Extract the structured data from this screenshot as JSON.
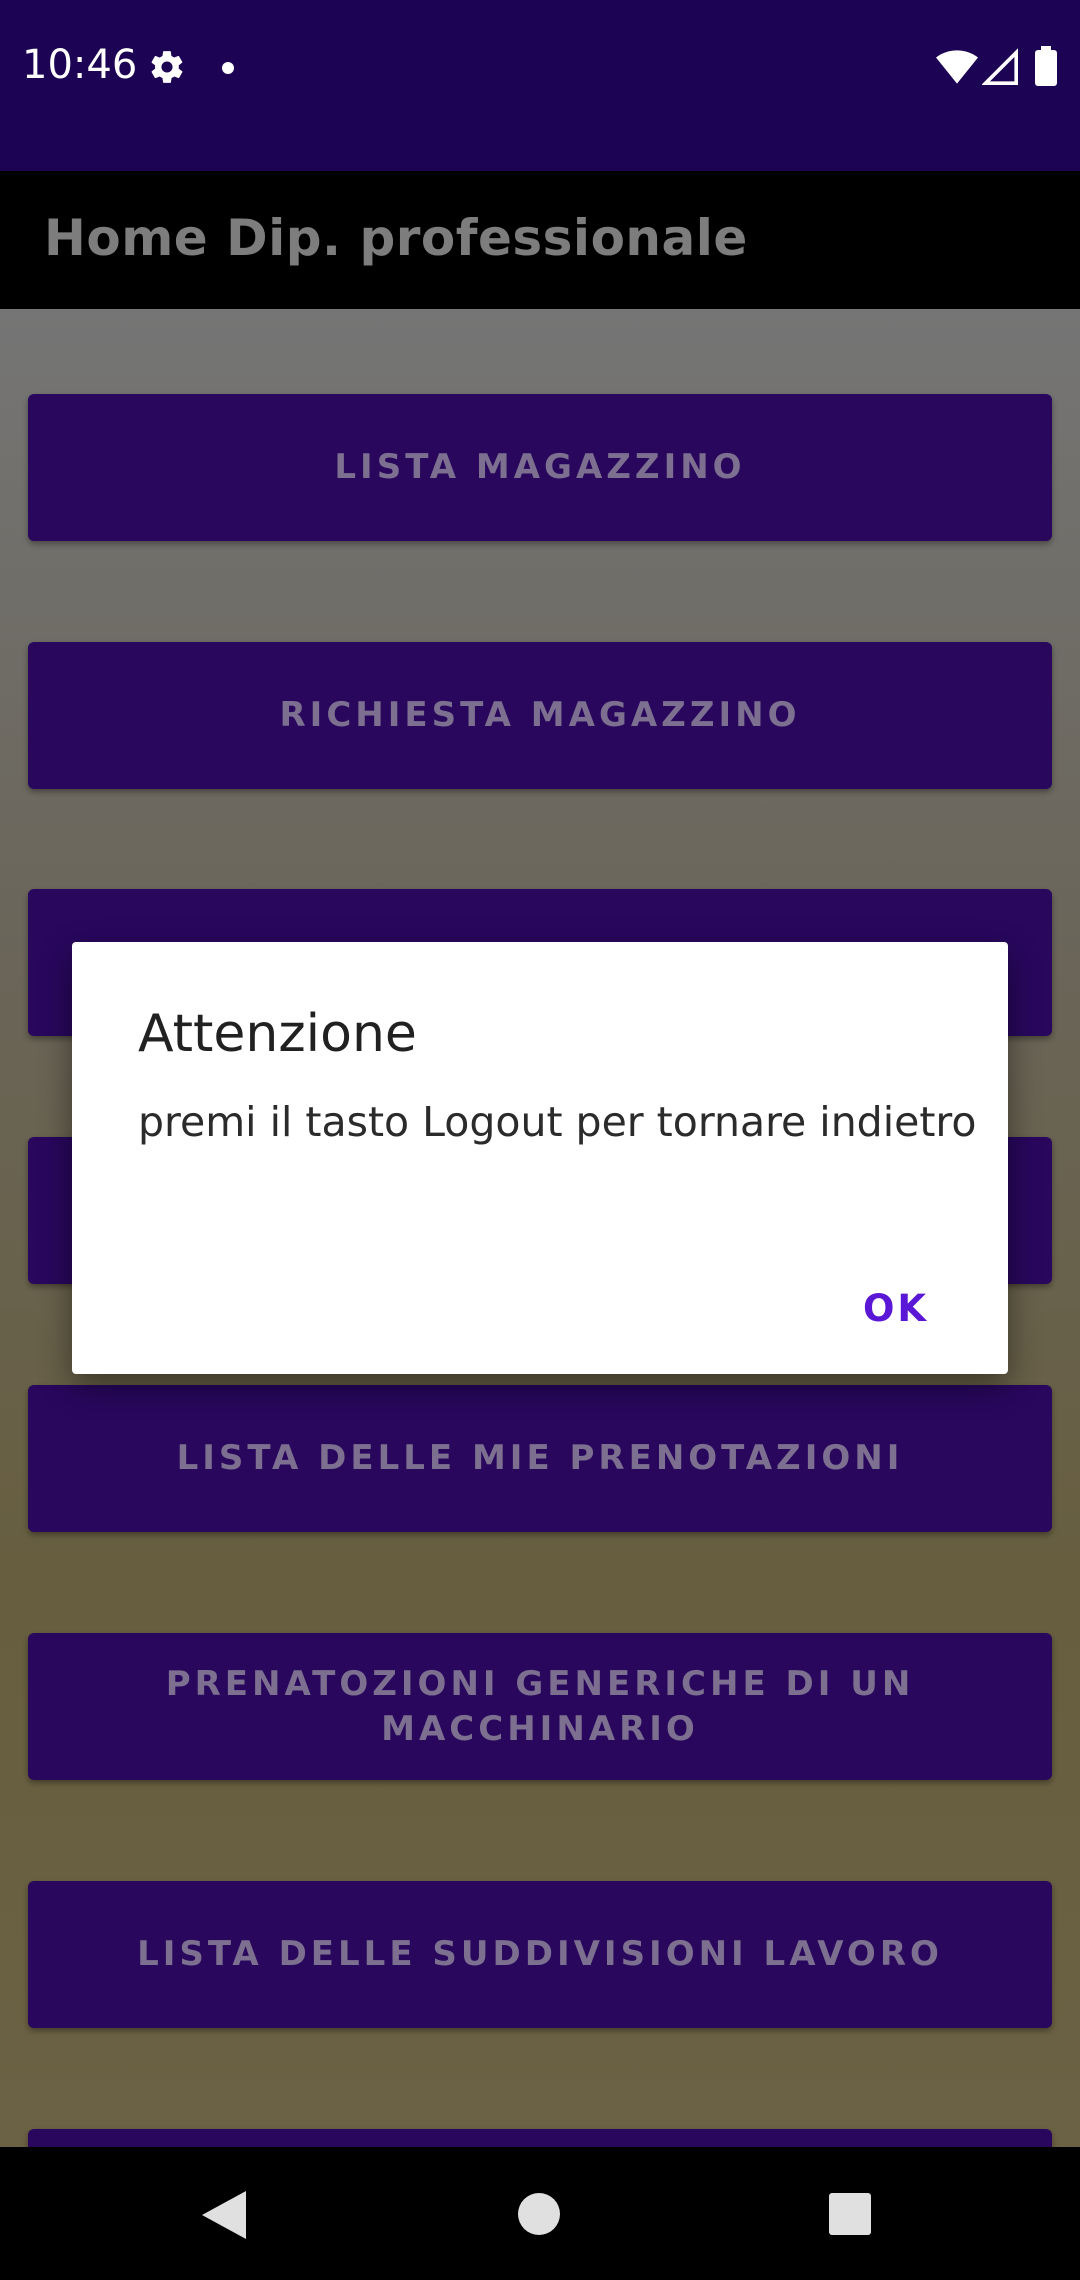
{
  "status_bar": {
    "time": "10:46",
    "icons": [
      "gear-icon",
      "notification-dot-icon",
      "wifi-icon",
      "signal-icon",
      "battery-icon"
    ]
  },
  "app_bar": {
    "title": "Home Dip. professionale"
  },
  "menu": {
    "buttons": [
      {
        "label": "LISTA MAGAZZINO"
      },
      {
        "label": "RICHIESTA MAGAZZINO"
      },
      {
        "label": ""
      },
      {
        "label": ""
      },
      {
        "label": "LISTA DELLE MIE PRENOTAZIONI"
      },
      {
        "label": "PRENATOZIONI GENERICHE DI UN MACCHINARIO"
      },
      {
        "label": "LISTA DELLE SUDDIVISIONI LAVORO"
      },
      {
        "label": ""
      }
    ]
  },
  "dialog": {
    "title": "Attenzione",
    "message": "premi il tasto Logout per tornare indietro",
    "ok_label": "OK"
  },
  "colors": {
    "status_bar": "#1c0353",
    "button": "#28075d",
    "accent": "#5a18d6"
  },
  "nav_bar": {
    "icons": [
      "back-icon",
      "home-icon",
      "recents-icon"
    ]
  }
}
